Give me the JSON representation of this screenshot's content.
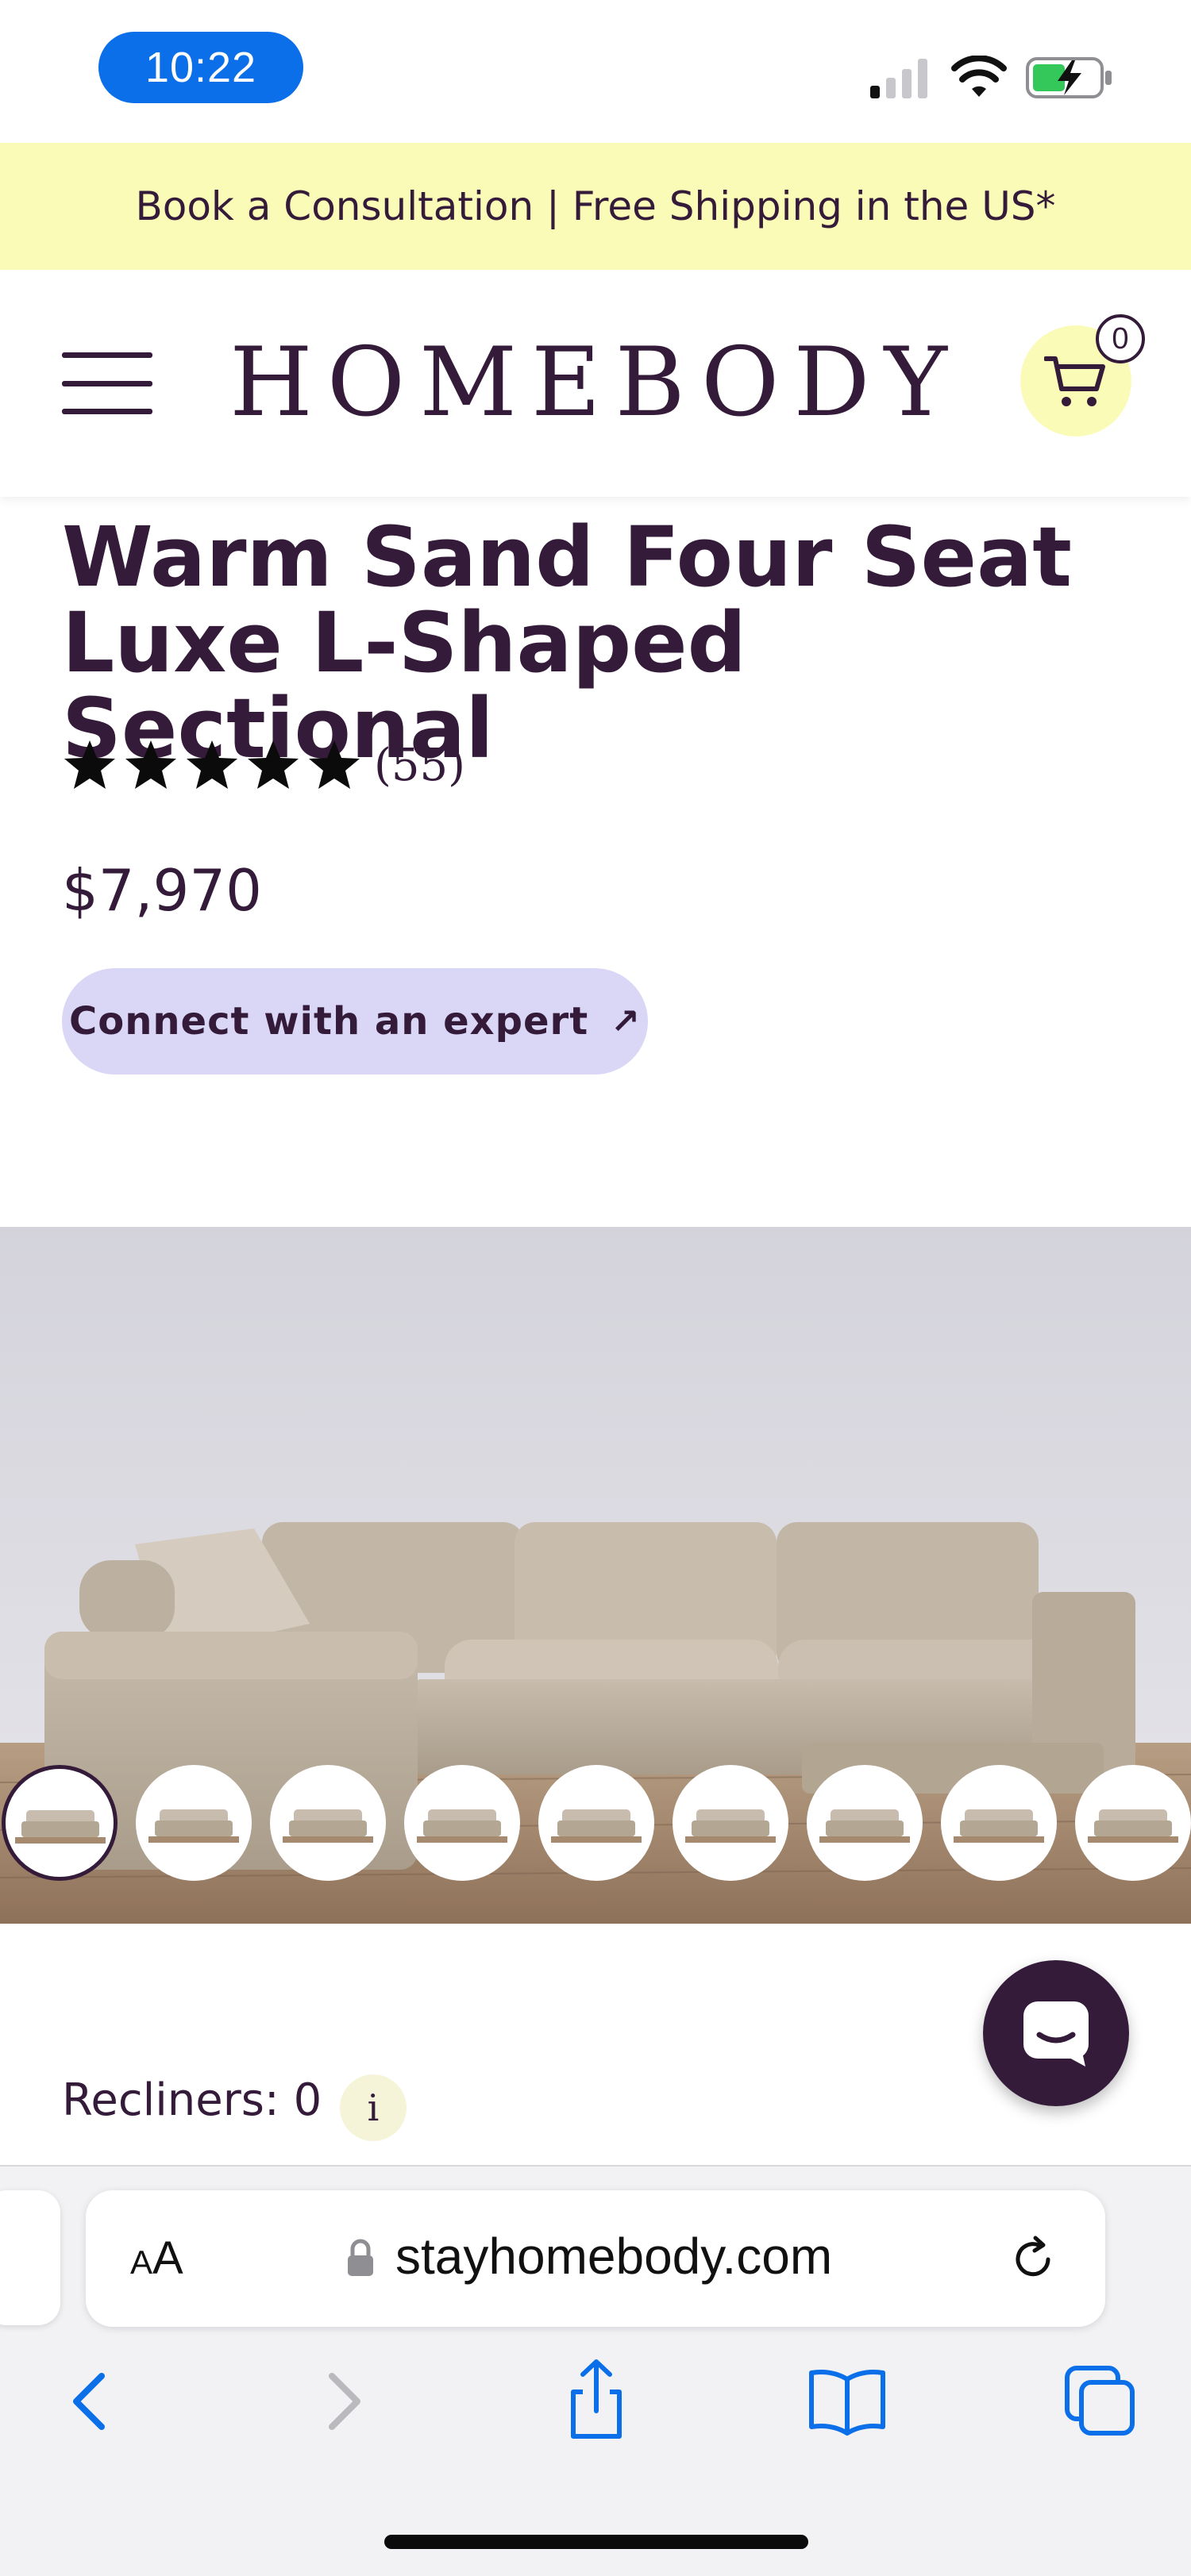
{
  "status_bar": {
    "time": "10:22",
    "icons": [
      "signal-icon",
      "wifi-icon",
      "battery-charging-icon"
    ]
  },
  "promo_banner": {
    "text": "Book a Consultation | Free Shipping in the US*",
    "background": "#fbfbb8"
  },
  "header": {
    "logo": "HOMEBODY",
    "menu_icon": "hamburger-menu-icon",
    "cart_icon": "shopping-cart-icon",
    "cart_count": "0"
  },
  "product": {
    "title_line1": "Warm Sand Four Seat",
    "title_line2": "Luxe L-Shaped Sectional",
    "rating_stars": 5,
    "review_count": "(55)",
    "price": "$7,970",
    "cta_label": "Connect with an expert",
    "cta_arrow": "↗"
  },
  "gallery": {
    "thumbnail_count": 9,
    "active_thumbnail": 0
  },
  "options": {
    "recliners_label": "Recliners: 0",
    "info_label": "i"
  },
  "chat": {
    "icon": "chat-icon"
  },
  "browser": {
    "aa_small": "A",
    "aa_big": "A",
    "url": "stayhomebody.com",
    "nav_icons": [
      "back-icon",
      "forward-icon",
      "share-icon",
      "bookmarks-icon",
      "tabs-icon"
    ]
  },
  "colors": {
    "brand": "#351b3a",
    "cta_bg": "#d9d6f6",
    "accent_yellow": "#fbfbb8",
    "safari_blue": "#0a6fe8"
  }
}
